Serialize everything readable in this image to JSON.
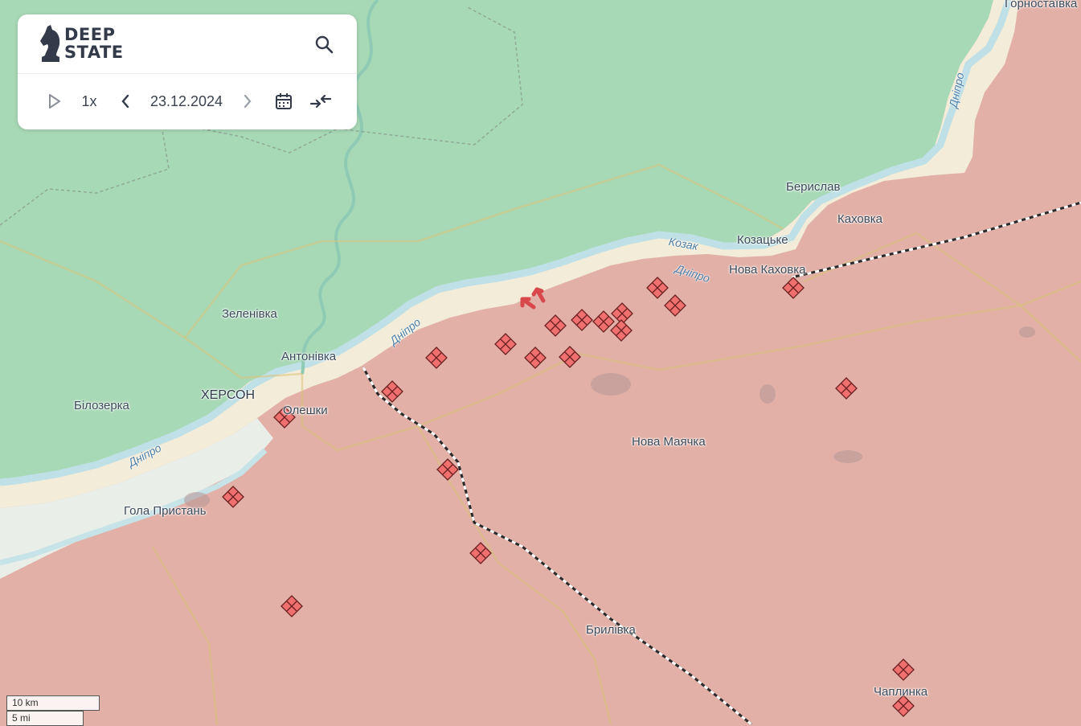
{
  "brand": {
    "line1": "DEEP",
    "line2": "STATE"
  },
  "icons": {
    "logo": "knight-chess-icon",
    "search": "search-icon",
    "play": "play-icon",
    "prev": "chevron-left-icon",
    "next": "chevron-right-icon",
    "calendar": "calendar-icon",
    "compare": "compare-arrows-icon"
  },
  "timeline": {
    "speed": "1x",
    "date": "23.12.2024"
  },
  "places": {
    "hornostaivka": "Горностаївка",
    "beryslav": "Берислав",
    "kakhovka": "Каховка",
    "kozatske": "Козацьке",
    "nova_kakhovka": "Нова Каховка",
    "zelenivka": "Зеленівка",
    "antonivka": "Антонівка",
    "kherson": "ХЕРСОН",
    "bilozerka": "Білозерка",
    "oleshky": "Олешки",
    "nova_mayachka": "Нова Маячка",
    "hola_prystan": "Гола Пристань",
    "brylivka": "Брилівка",
    "chaplynka": "Чаплинка"
  },
  "rivers": {
    "dnipro_a": "Дніпро",
    "dnipro_b": "Дніпро",
    "dnipro_c": "Дніпро",
    "dnipro_d": "Дніпро",
    "kozak": "Козак"
  },
  "scale": {
    "metric": "10 km",
    "imperial": "5 mi"
  },
  "colors": {
    "ukraine_controlled": "#a8d9b6",
    "occupied": "#e2b0a6",
    "contested": "#f3ecd9",
    "water": "#cfe8ec",
    "marker_fill": "#f07070",
    "marker_stroke": "#6b2020",
    "arrow": "#d8474b",
    "front_line": "#2a2a2a"
  },
  "markers": {
    "count_label": "",
    "type": "shelling-cross-diamond"
  }
}
